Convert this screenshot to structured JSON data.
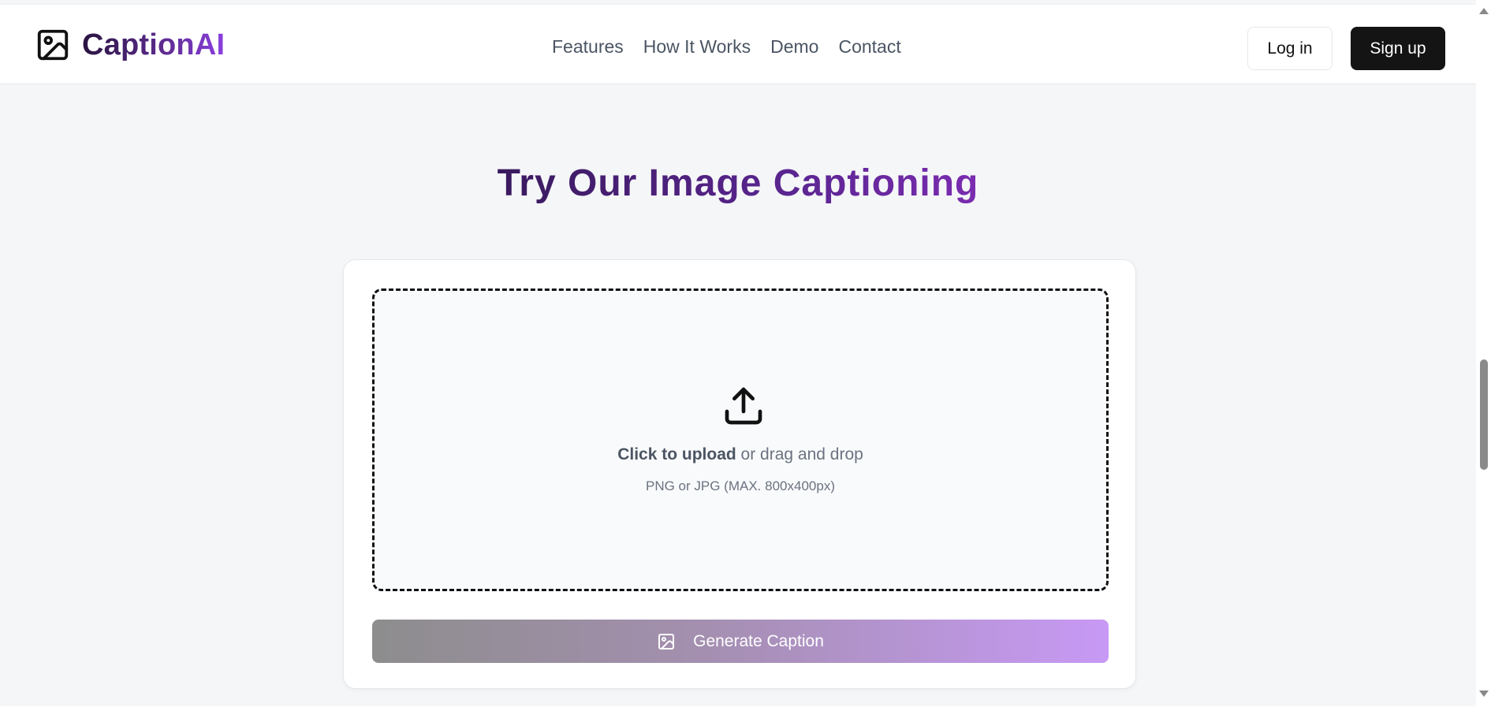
{
  "header": {
    "brand": {
      "name_part1": "Caption",
      "name_part2": "AI"
    },
    "nav": [
      {
        "label": "Features"
      },
      {
        "label": "How It Works"
      },
      {
        "label": "Demo"
      },
      {
        "label": "Contact"
      }
    ],
    "login_label": "Log in",
    "signup_label": "Sign up"
  },
  "main": {
    "title": "Try Our Image Captioning",
    "upload": {
      "action_bold": "Click to upload",
      "action_rest": " or drag and drop",
      "hint": "PNG or JPG (MAX. 800x400px)"
    },
    "generate_label": "Generate Caption"
  },
  "icons": {
    "logo": "image-icon",
    "upload": "upload-icon",
    "generate": "image-icon"
  },
  "colors": {
    "brand_dark": "#2a1440",
    "brand_accent": "#8b3fe0",
    "signup_bg": "#141414",
    "generate_start": "#8d8d8d",
    "generate_end": "#c799f5"
  }
}
